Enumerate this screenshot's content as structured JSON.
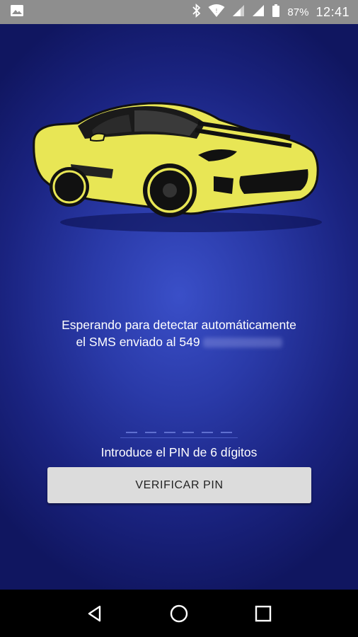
{
  "status_bar": {
    "battery_percent": "87%",
    "time": "12:41",
    "icons": [
      "image-icon",
      "bluetooth-icon",
      "wifi-icon",
      "signal-icon",
      "signal-icon",
      "battery-icon"
    ]
  },
  "app": {
    "car_color": "#e8e655",
    "background_color": "#1a2380",
    "message_line1": "Esperando para detectar automáticamente",
    "message_line2": "el SMS enviado al 549",
    "pin_label": "Introduce el PIN de 6 dígitos",
    "pin_value": "",
    "verify_button_label": "VERIFICAR PIN"
  },
  "nav_bar": {
    "icons": [
      "back-icon",
      "home-icon",
      "recents-icon"
    ]
  }
}
